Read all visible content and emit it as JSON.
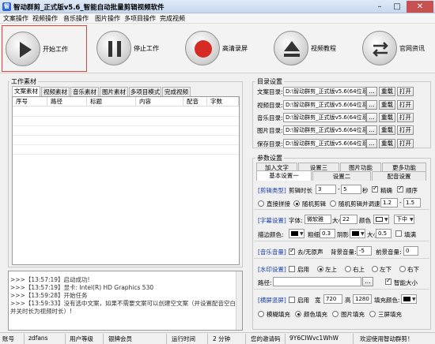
{
  "window": {
    "title": "智动群剪_正式版v5.6_智能自动批量剪辑视频软件"
  },
  "menu": [
    "文案操作",
    "视频操作",
    "音乐操作",
    "图片操作",
    "多项目操作",
    "完成视频"
  ],
  "toolbar": {
    "start": "开始工作",
    "stop": "停止工作",
    "record": "高清录屏",
    "tutorial": "视频教程",
    "website": "官网资讯"
  },
  "work": {
    "title": "工作素材",
    "tabs": [
      "文案素材",
      "视频素材",
      "音乐素材",
      "图片素材",
      "多项目模式",
      "完成视频"
    ],
    "columns": [
      "序号",
      "路径",
      "标题",
      "内容",
      "配音",
      "字数"
    ]
  },
  "log": [
    ">>>【13:57:19】启动成功!",
    ">>>【13:57:19】显卡: Intel(R) HD Graphics 530",
    ">>>【13:59:28】开始任务",
    ">>>【13:59:33】没有选中文案，如果不需要文案可以创建空文案（并设置配音空白窗时",
    "并关时长为视频时长）!"
  ],
  "dirs": {
    "title": "目录设置",
    "rows": [
      {
        "label": "文案目录:",
        "path": "D:\\智动群剪_正式版v5.6(64位系"
      },
      {
        "label": "视频目录:",
        "path": "D:\\智动群剪_正式版v5.6(64位系"
      },
      {
        "label": "音乐目录:",
        "path": "D:\\智动群剪_正式版v5.6(64位系"
      },
      {
        "label": "图片目录:",
        "path": "D:\\智动群剪_正式版v5.6(64位系"
      },
      {
        "label": "保存目录:",
        "path": "D:\\智动群剪_正式版v5.6(64位系"
      }
    ],
    "dots": "...",
    "reset": "重载",
    "open": "打开"
  },
  "params": {
    "title": "参数设置",
    "tabs_row1": [
      "加入文字",
      "设置三",
      "图片功能",
      "更多功能"
    ],
    "tabs_row2": [
      "基本设置一",
      "设置二",
      "配音设置"
    ],
    "clip": {
      "label": "[剪辑类型]",
      "duration_label": "剪辑时长",
      "min": "3",
      "max": "5",
      "unit": "秒",
      "precise": "精确",
      "order": "顺序",
      "direct": "直接拼接",
      "random": "随机剪辑",
      "random_speed": "随机剪辑并调速",
      "speed_min": "1.2",
      "speed_max": "1.5"
    },
    "subtitle": {
      "label": "[字幕设置]",
      "font_label": "字体:",
      "font": "微软雅",
      "size_label": "大小",
      "size": "22",
      "color_label": "颜色",
      "pos": "下中",
      "stroke_label": "描边颜色:",
      "bold_label": "粗细",
      "bold": "0.3",
      "shadow_label": "阴影",
      "shadow_size_label": "大小",
      "shadow_size": "0.5",
      "fill": "填满"
    },
    "music": {
      "label": "[音乐音量]",
      "mute": "去/无原声",
      "bg_label": "背景音量:",
      "bg": "-5",
      "front_label": "前景音量:",
      "front": "0"
    },
    "watermark": {
      "label": "[水印设置]",
      "enable": "启用",
      "positions": [
        "左上",
        "右上",
        "左下",
        "右下"
      ],
      "path_label": "路径:",
      "dots": "...",
      "auto_size": "智能大小"
    },
    "screen": {
      "label": "[横屏竖屏]",
      "enable": "启用",
      "w_label": "宽",
      "w": "720",
      "h_label": "高",
      "h": "1280",
      "fill_color_label": "填充颜色:",
      "modes": [
        "模糊填充",
        "颜色填充",
        "图片填充",
        "三屏填充"
      ]
    }
  },
  "status": {
    "account_label": "账号",
    "account": "zdfans",
    "level_label": "用户等级",
    "level": "银牌会员",
    "runtime_label": "运行时间",
    "runtime": "2 分钟",
    "code_label": "您的邀请码",
    "code": "9Y6CIWvc1WhW",
    "welcome": "欢迎使用智动群剪！"
  },
  "colors": {
    "accent_red": "#e3413a",
    "title_blue": "#1a3fa8"
  }
}
